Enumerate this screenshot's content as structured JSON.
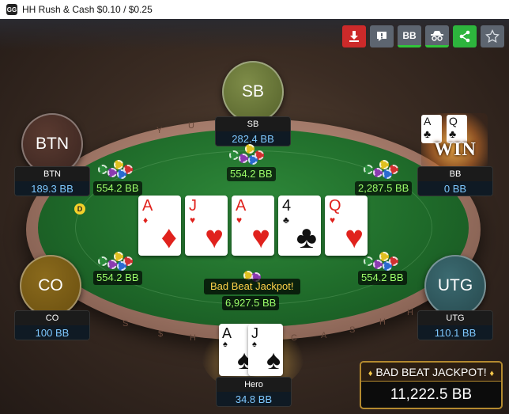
{
  "window": {
    "logo_text": "GG",
    "title": "HH  Rush & Cash $0.10 / $0.25"
  },
  "toolbar": {
    "download_icon": "download-icon",
    "note_icon": "note-icon",
    "bb_label": "BB",
    "spy_icon": "spy-icon",
    "share_icon": "share-icon",
    "star_icon": "star-icon",
    "active_color": "#31c43a"
  },
  "seats": {
    "sb": {
      "position": "SB",
      "name": "SB",
      "stack": "282.4 BB",
      "bet": "554.2 BB"
    },
    "btn": {
      "position": "BTN",
      "name": "BTN",
      "stack": "189.3 BB",
      "bet": "554.2 BB"
    },
    "bb": {
      "name": "BB",
      "stack": "0 BB",
      "bet": "2,287.5 BB",
      "cards": [
        {
          "rank": "A",
          "suit": "♣"
        },
        {
          "rank": "Q",
          "suit": "♣"
        }
      ],
      "win_label": "WIN"
    },
    "co": {
      "position": "CO",
      "name": "CO",
      "stack": "100 BB",
      "bet": "554.2 BB"
    },
    "utg": {
      "position": "UTG",
      "name": "UTG",
      "stack": "110.1 BB",
      "bet": "554.2 BB"
    },
    "hero": {
      "name": "Hero",
      "stack": "34.8 BB",
      "cards": [
        {
          "rank": "A",
          "suit": "♠"
        },
        {
          "rank": "J",
          "suit": "♠"
        }
      ]
    }
  },
  "dealer_button": "D",
  "board": [
    {
      "rank": "A",
      "suit": "♦",
      "color": "red"
    },
    {
      "rank": "J",
      "suit": "♥",
      "color": "red"
    },
    {
      "rank": "A",
      "suit": "♥",
      "color": "red"
    },
    {
      "rank": "4",
      "suit": "♣",
      "color": "black"
    },
    {
      "rank": "Q",
      "suit": "♥",
      "color": "red"
    }
  ],
  "pot": {
    "label": "Bad Beat Jackpot!",
    "amount": "6,927.5 BB"
  },
  "jackpot": {
    "title": "BAD BEAT JACKPOT!",
    "diamond": "♦",
    "amount": "11,222.5 BB"
  },
  "rail_text": [
    "Y",
    "U",
    "$",
    "H",
    "C",
    "A",
    "S",
    "H",
    "S",
    "H"
  ],
  "colors": {
    "felt": "#1f6b2a",
    "bet_text": "#9dff6a",
    "stack_text": "#7ec8ff",
    "pot_label": "#ffd24a",
    "jackpot_border": "#b48a2f"
  }
}
